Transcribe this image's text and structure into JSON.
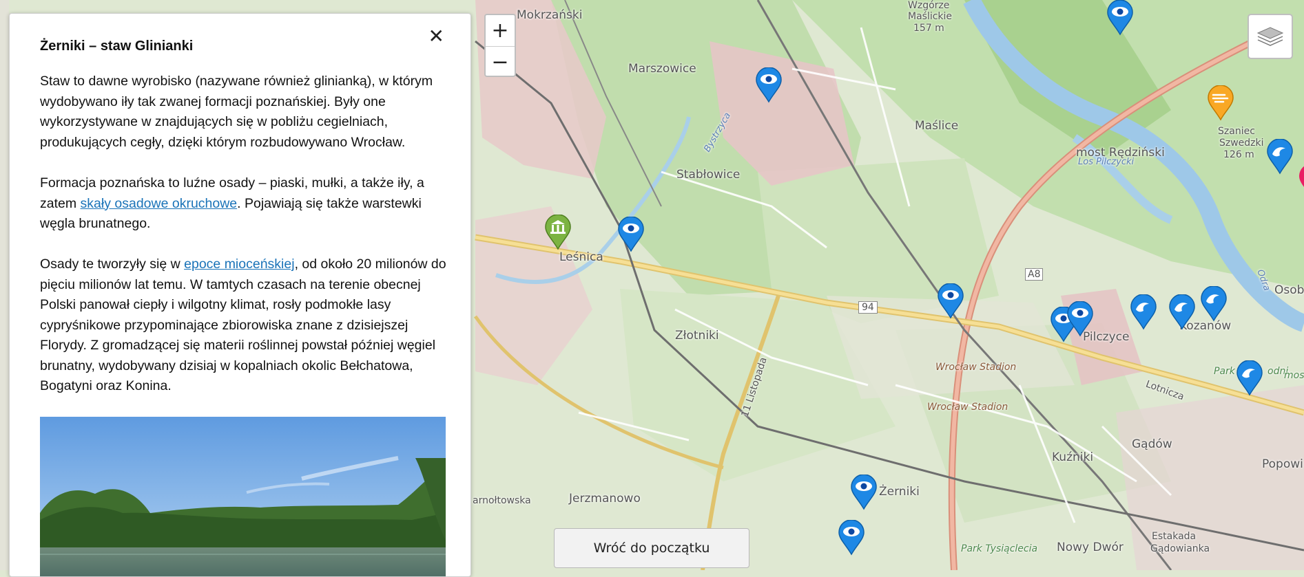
{
  "panel": {
    "title": "Żerniki – staw Glinianki",
    "close_glyph": "✕",
    "p1": "Staw to dawne wyrobisko (nazywane również glinianką), w którym wydobywano iły tak zwanej formacji poznańskiej. Były one wykorzystywane w znajdujących się w pobliżu cegielniach, produkujących cegły, dzięki którym rozbudowywano Wrocław.",
    "p2_before": "Formacja poznańska to luźne osady – piaski, mułki, a także iły, a zatem ",
    "p2_link": "skały osadowe okruchowe",
    "p2_after": ". Pojawiają się także warstewki węgla brunatnego.",
    "p3_before": "Osady te tworzyły się w ",
    "p3_link": "epoce mioceńskiej",
    "p3_after": ", od około 20 milionów do pięciu milionów lat temu. W tamtych czasach na terenie obecnej Polski panował ciepły i wilgotny klimat, rosły podmokłe lasy cypryśnikowe przypominające zbiorowiska znane z dzisiejszej Florydy. Z gromadzącej się materii roślinnej powstał później węgiel brunatny, wydobywany dzisiaj w kopalniach okolic Bełchatowa, Bogatyni oraz Konina."
  },
  "controls": {
    "zoom_in": "+",
    "zoom_out": "−",
    "back_button": "Wróć do początku"
  },
  "map": {
    "labels": {
      "mokrzanski": "Mokrzański",
      "wzgorze": "Wzgórze",
      "maslickie": "Maślickie",
      "wzgorze_height": "157 m",
      "marszowice": "Marszowice",
      "maslice": "Maślice",
      "szaniec": "Szaniec",
      "szwedzki": "Szwedzki",
      "szaniec_height": "126 m",
      "most": "most Rędziński",
      "los_pilczycki": "Los Pilczycki",
      "bystrzyca": "Bystrzyca",
      "stablowice": "Stabłowice",
      "lesnica": "Leśnica",
      "a8": "A8",
      "osob": "Osob",
      "odra": "Odra",
      "road94": "94",
      "zlotniki": "Złotniki",
      "pilczyce": "Pilczyce",
      "kozanow": "Kozanów",
      "stadion1": "Wrocław Stadion",
      "stadion2": "Wrocław Stadion",
      "listopada": "11 Listopada",
      "lotnicza": "Lotnicza",
      "park_mos": "mos",
      "park_odni": "Park",
      "park_odni2": "odni",
      "gadow": "Gądów",
      "popowi": "Popowi",
      "kuzniki": "Kuźniki",
      "arnoltowska": "arnołtowska",
      "jerzmanowo": "Jerzmanowo",
      "zerniki": "Żerniki",
      "park_tysiaclecia": "Park Tysiąclecia",
      "nowy_dwor": "Nowy Dwór",
      "estakada": "Estakada",
      "gadowianka": "Gądowianka"
    }
  },
  "colors": {
    "marker_eye": "#1e88e5",
    "marker_museum": "#7cb342",
    "marker_wind": "#f9a825",
    "link": "#1a73b8"
  }
}
